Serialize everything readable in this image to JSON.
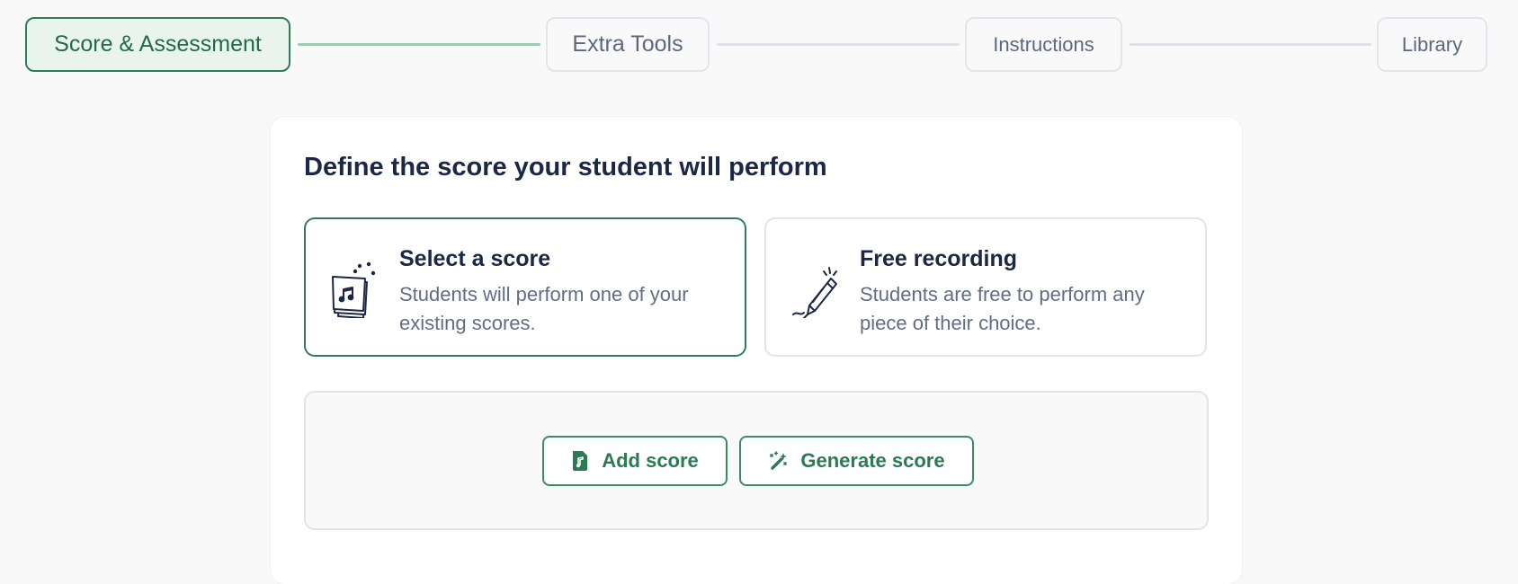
{
  "stepper": {
    "steps": [
      {
        "label": "Score & Assessment",
        "state": "active"
      },
      {
        "label": "Extra Tools",
        "state": "pending"
      },
      {
        "label": "Instructions",
        "state": "pending"
      },
      {
        "label": "Library",
        "state": "pending"
      }
    ]
  },
  "card": {
    "title": "Define the score your student will perform",
    "options": [
      {
        "title": "Select a score",
        "description": "Students will perform one of your existing scores.",
        "icon": "sheet-music-icon",
        "selected": true
      },
      {
        "title": "Free recording",
        "description": "Students are free to perform any piece of their choice.",
        "icon": "pencil-icon",
        "selected": false
      }
    ],
    "actions": {
      "add_score": {
        "label": "Add score",
        "icon": "music-file-icon"
      },
      "generate_score": {
        "label": "Generate score",
        "icon": "magic-wand-icon"
      }
    }
  },
  "colors": {
    "accent": "#2f7d57",
    "accent_light": "#e9f4ee",
    "text_dark": "#1c2743",
    "text_muted": "#626d84",
    "border": "#e2e4e9"
  }
}
